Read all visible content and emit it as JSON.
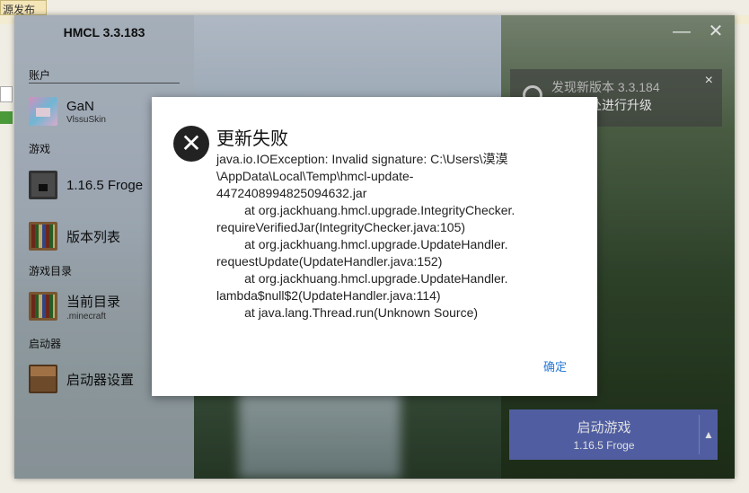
{
  "background": {
    "tab_text": "源发布"
  },
  "app": {
    "title": "HMCL 3.3.183"
  },
  "window_controls": {
    "minimize": "—",
    "close": "✕"
  },
  "sidebar": {
    "account_label": "账户",
    "account_name": "GaN",
    "account_sub": "VlssuSkin",
    "game_label": "游戏",
    "game_current": "1.16.5 Froge",
    "version_list": "版本列表",
    "dir_label": "游戏目录",
    "dir_current": "当前目录",
    "dir_sub": ".minecraft",
    "launcher_label": "启动器",
    "launcher_settings": "启动器设置"
  },
  "update_card": {
    "title": "发现新版本 3.3.184",
    "text": "点击此处进行升级",
    "close": "×"
  },
  "launch": {
    "label": "启动游戏",
    "version": "1.16.5 Froge",
    "arrow": "▲"
  },
  "dialog": {
    "title": "更新失败",
    "message": "java.io.IOException: Invalid signature: C:\\Users\\漠漠\n\\AppData\\Local\\Temp\\hmcl-update-\n4472408994825094632.jar\n        at org.jackhuang.hmcl.upgrade.IntegrityChecker.\nrequireVerifiedJar(IntegrityChecker.java:105)\n        at org.jackhuang.hmcl.upgrade.UpdateHandler.\nrequestUpdate(UpdateHandler.java:152)\n        at org.jackhuang.hmcl.upgrade.UpdateHandler.\nlambda$null$2(UpdateHandler.java:114)\n        at java.lang.Thread.run(Unknown Source)",
    "ok_label": "确定",
    "icon": "close-icon"
  }
}
